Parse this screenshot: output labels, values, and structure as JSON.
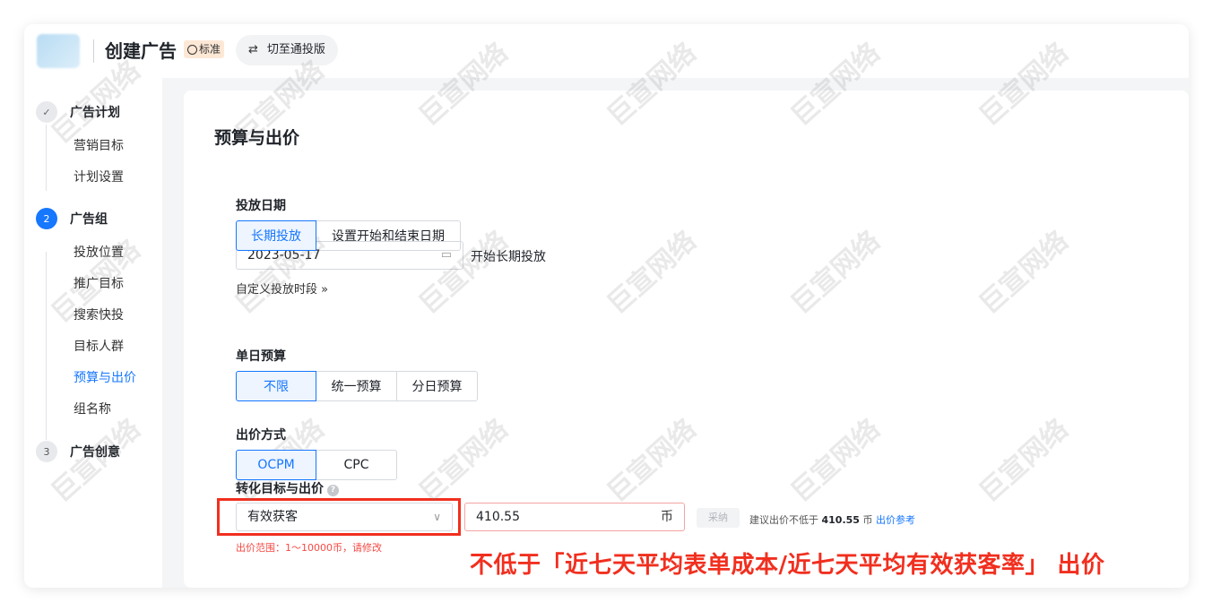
{
  "header": {
    "title": "创建广告",
    "edition_badge": "标准",
    "switch_label": "切至通投版"
  },
  "sidebar": {
    "steps": [
      {
        "number": "✓",
        "label": "广告计划",
        "items": [
          "营销目标",
          "计划设置"
        ]
      },
      {
        "number": "2",
        "label": "广告组",
        "items": [
          "投放位置",
          "推广目标",
          "搜索快投",
          "目标人群",
          "预算与出价",
          "组名称"
        ]
      },
      {
        "number": "3",
        "label": "广告创意",
        "items": []
      }
    ],
    "current_item": "预算与出价"
  },
  "main": {
    "section_title": "预算与出价",
    "schedule": {
      "label": "投放日期",
      "options": [
        "长期投放",
        "设置开始和结束日期"
      ],
      "selected": "长期投放",
      "start_date": "2023-05-17",
      "start_note": "开始长期投放",
      "custom_link": "自定义投放时段 »"
    },
    "daily_budget": {
      "label": "单日预算",
      "options": [
        "不限",
        "统一预算",
        "分日预算"
      ],
      "selected": "不限"
    },
    "bid_method": {
      "label": "出价方式",
      "options": [
        "OCPM",
        "CPC"
      ],
      "selected": "OCPM"
    },
    "conversion": {
      "label": "转化目标与出价",
      "goal_value": "有效获客",
      "bid_value": "410.55",
      "bid_unit": "币",
      "adopt_label": "采纳",
      "suggest_prefix": "建议出价不低于",
      "suggest_value": "410.55",
      "suggest_unit": "币",
      "suggest_link": "出价参考",
      "range_error": "出价范围：1～10000币，请修改"
    }
  },
  "annotation": {
    "text": "不低于「近七天平均表单成本/近七天平均有效获客率」 出价"
  },
  "watermark": "巨宣网络",
  "colors": {
    "accent": "#1677ff",
    "error": "#f54a45",
    "annotation_red": "#f12f1f"
  }
}
